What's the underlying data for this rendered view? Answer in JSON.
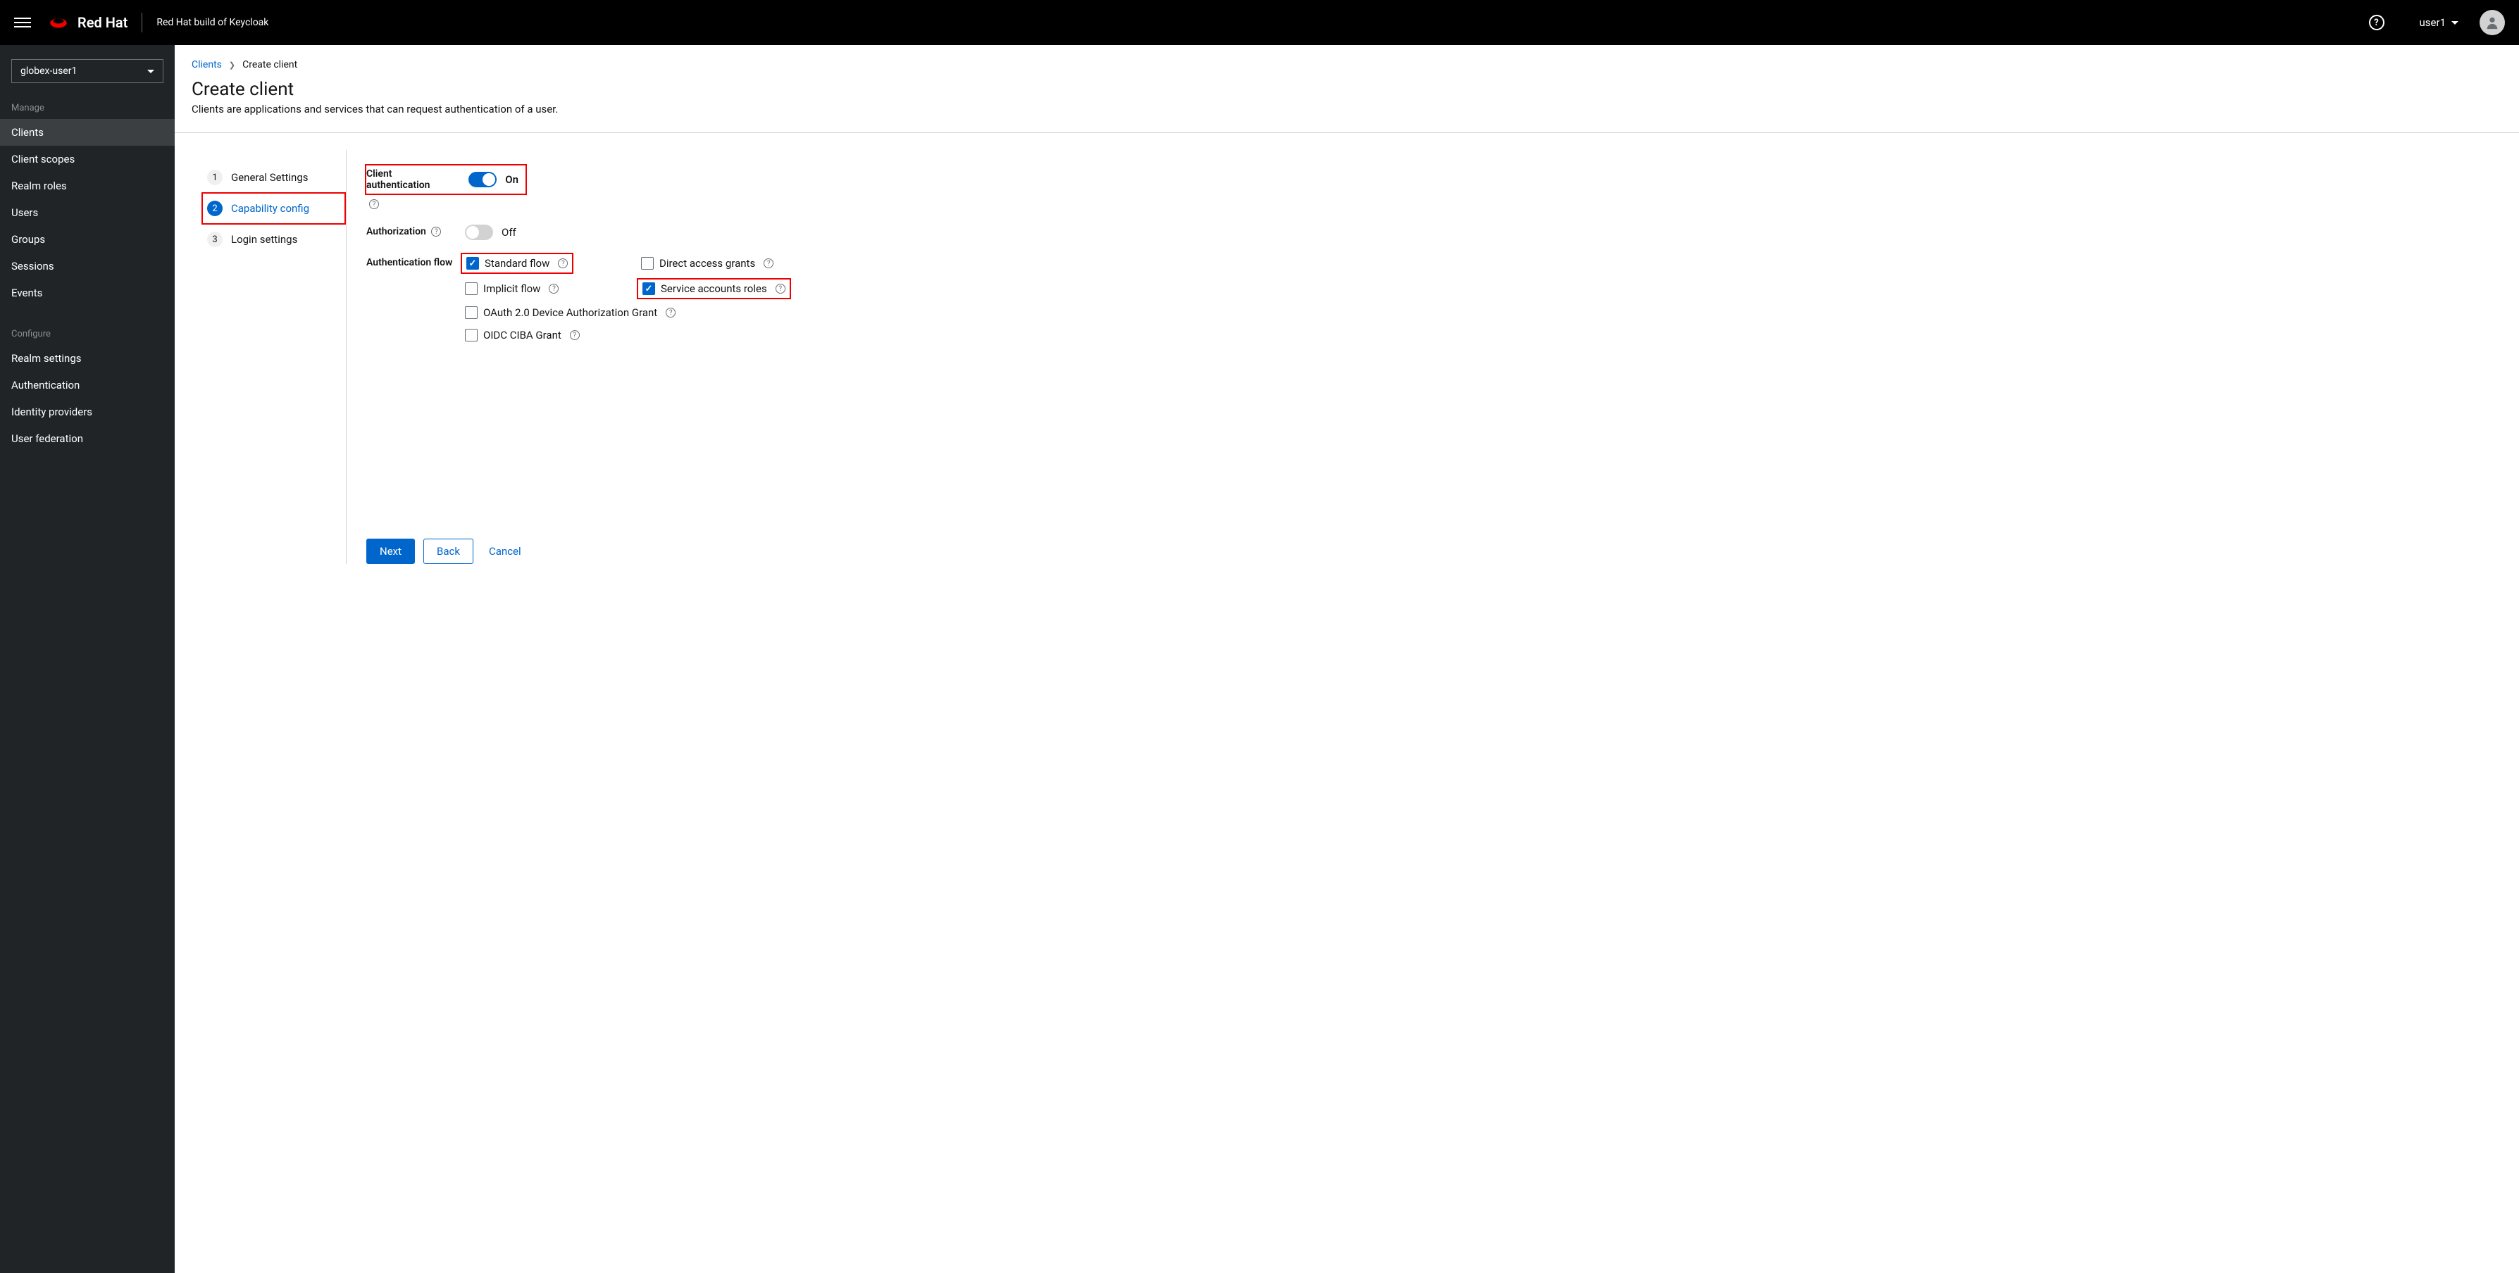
{
  "header": {
    "brand": "Red Hat",
    "product": "Red Hat build of Keycloak",
    "username": "user1"
  },
  "sidebar": {
    "realm": "globex-user1",
    "heading_manage": "Manage",
    "heading_configure": "Configure",
    "manage_items": [
      {
        "label": "Clients",
        "active": true
      },
      {
        "label": "Client scopes",
        "active": false
      },
      {
        "label": "Realm roles",
        "active": false
      },
      {
        "label": "Users",
        "active": false
      },
      {
        "label": "Groups",
        "active": false
      },
      {
        "label": "Sessions",
        "active": false
      },
      {
        "label": "Events",
        "active": false
      }
    ],
    "configure_items": [
      {
        "label": "Realm settings"
      },
      {
        "label": "Authentication"
      },
      {
        "label": "Identity providers"
      },
      {
        "label": "User federation"
      }
    ]
  },
  "breadcrumb": {
    "parent": "Clients",
    "current": "Create client"
  },
  "page": {
    "title": "Create client",
    "description": "Clients are applications and services that can request authentication of a user."
  },
  "wizard": {
    "steps": [
      {
        "num": "1",
        "label": "General Settings",
        "active": false
      },
      {
        "num": "2",
        "label": "Capability config",
        "active": true
      },
      {
        "num": "3",
        "label": "Login settings",
        "active": false
      }
    ]
  },
  "form": {
    "client_auth": {
      "label": "Client authentication",
      "value": "On",
      "on": true
    },
    "authorization": {
      "label": "Authorization",
      "value": "Off",
      "on": false
    },
    "auth_flow_label": "Authentication flow",
    "flows": {
      "standard": {
        "label": "Standard flow",
        "checked": true
      },
      "direct": {
        "label": "Direct access grants",
        "checked": false
      },
      "implicit": {
        "label": "Implicit flow",
        "checked": false
      },
      "service": {
        "label": "Service accounts roles",
        "checked": true
      },
      "oauth_device": {
        "label": "OAuth 2.0 Device Authorization Grant",
        "checked": false
      },
      "oidc_ciba": {
        "label": "OIDC CIBA Grant",
        "checked": false
      }
    }
  },
  "footer": {
    "next": "Next",
    "back": "Back",
    "cancel": "Cancel"
  }
}
